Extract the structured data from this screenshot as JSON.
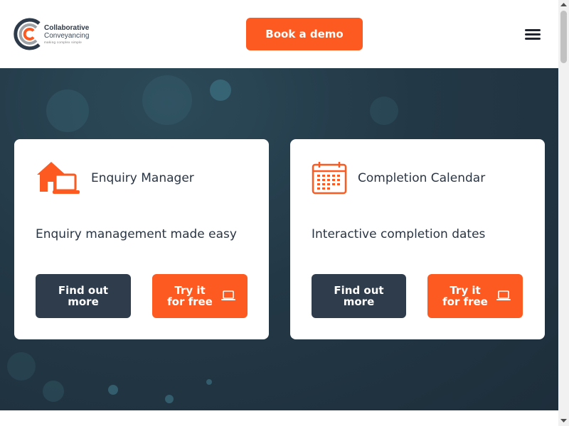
{
  "header": {
    "logo": {
      "line1": "Collaborative",
      "line2": "Conveyancing",
      "tagline": "making complex simple"
    },
    "demo_button": "Book a demo",
    "menu_icon": "hamburger-icon"
  },
  "cards": [
    {
      "icon": "house-laptop-icon",
      "title": "Enquiry Manager",
      "subtitle": "Enquiry management made easy",
      "find_out_more": "Find out more",
      "try_free": "Try it for free",
      "try_icon": "laptop-icon"
    },
    {
      "icon": "calendar-icon",
      "title": "Completion Calendar",
      "subtitle": "Interactive completion dates",
      "find_out_more": "Find out more",
      "try_free": "Try it for free",
      "try_icon": "laptop-icon"
    }
  ],
  "colors": {
    "accent": "#fd5a22",
    "dark_button": "#2f3c4c",
    "hero_bg": "#233846",
    "text": "#2a3544"
  }
}
